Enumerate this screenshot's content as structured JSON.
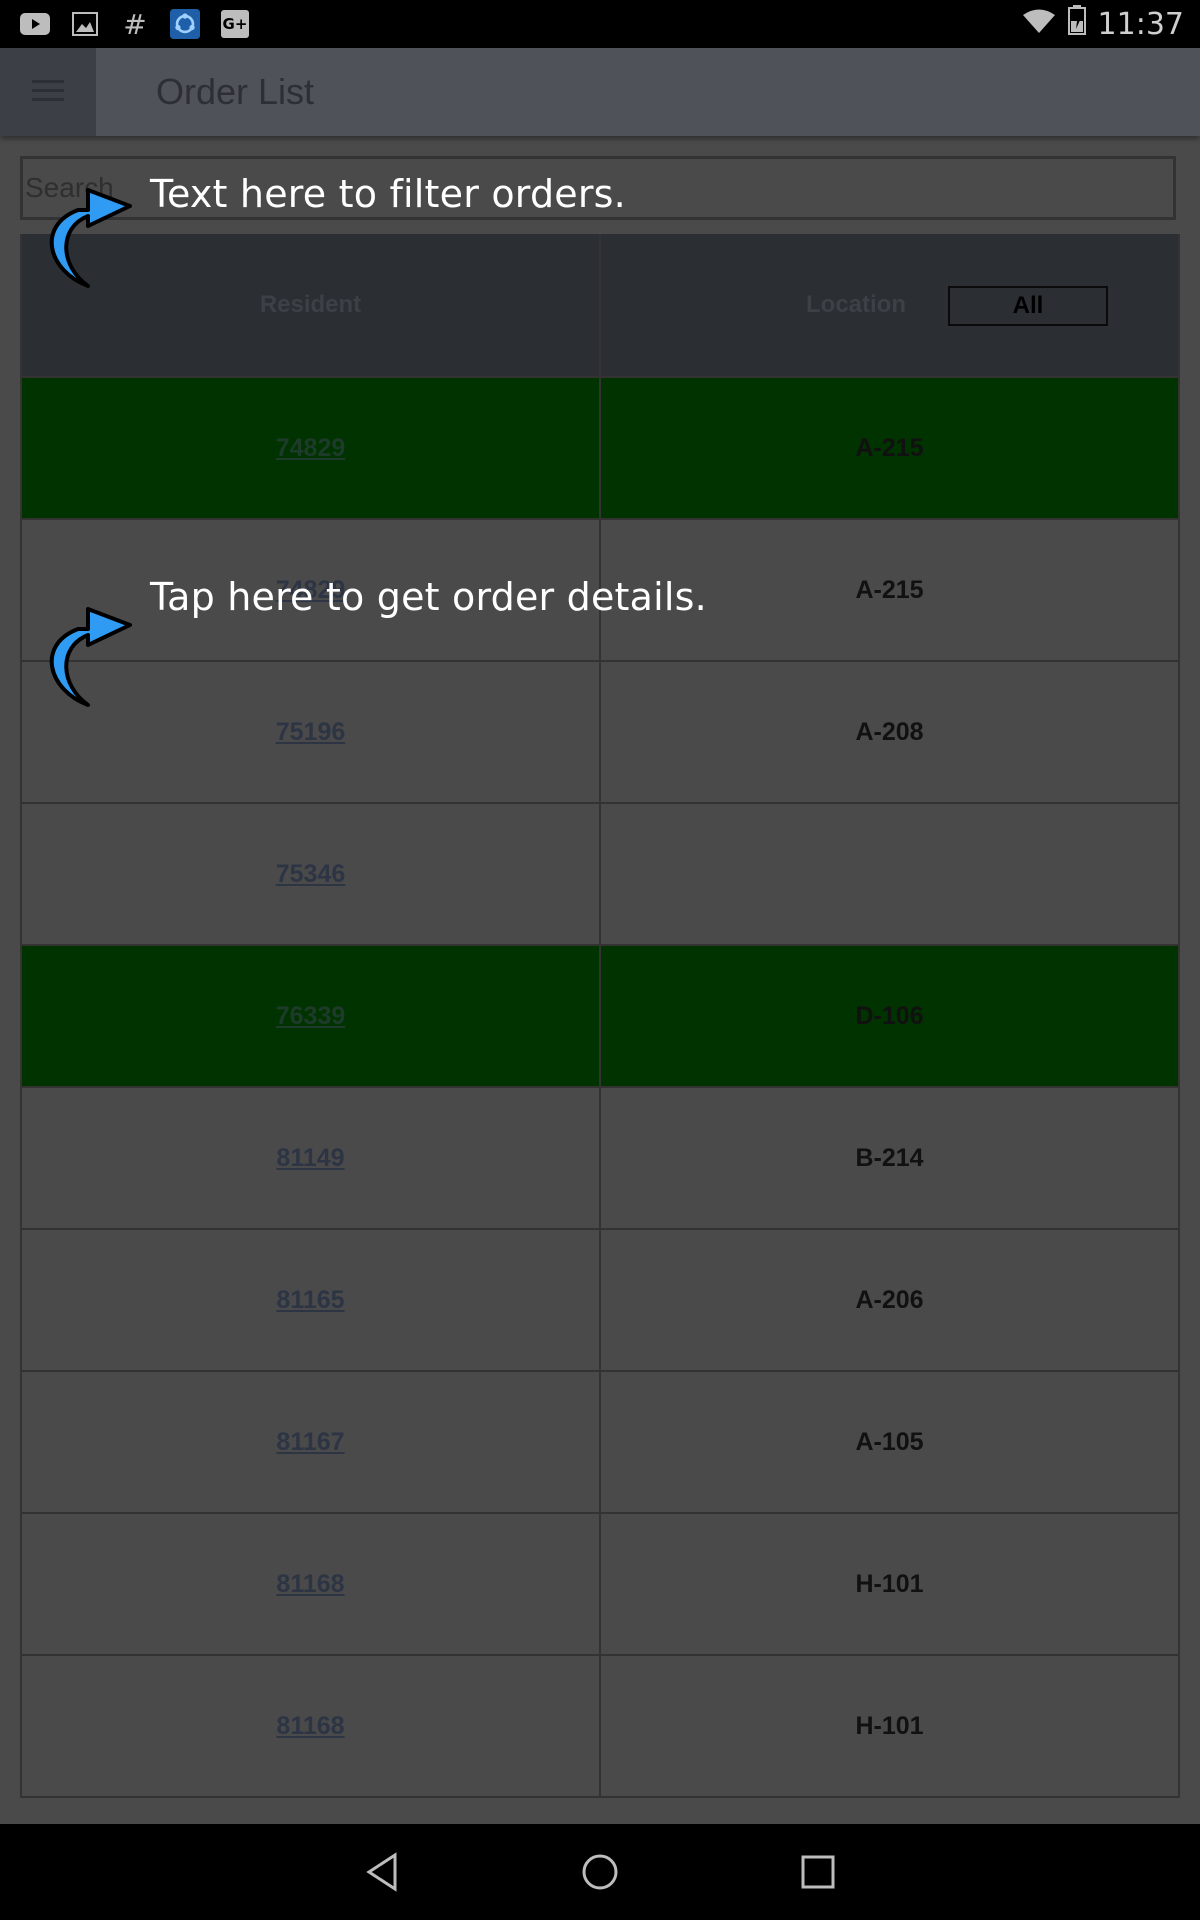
{
  "status_bar": {
    "time": "11:37",
    "left_icons": [
      "youtube-icon",
      "gallery-icon",
      "hashtag-icon",
      "sync-app-icon",
      "google-plus-icon"
    ],
    "right_icons": [
      "wifi-icon",
      "battery-charging-icon"
    ],
    "gplus_text": "G+",
    "hash_text": "#"
  },
  "app_bar": {
    "title": "Order List",
    "menu_icon": "hamburger-menu-icon"
  },
  "search": {
    "placeholder": "Search"
  },
  "table": {
    "headers": {
      "resident": "Resident",
      "location": "Location"
    },
    "filter_button": "All",
    "rows": [
      {
        "resident": "74829",
        "location": "A-215",
        "highlight": true
      },
      {
        "resident": "74829",
        "location": "A-215",
        "highlight": false
      },
      {
        "resident": "75196",
        "location": "A-208",
        "highlight": false
      },
      {
        "resident": "75346",
        "location": "",
        "highlight": false
      },
      {
        "resident": "76339",
        "location": "D-106",
        "highlight": true
      },
      {
        "resident": "81149",
        "location": "B-214",
        "highlight": false
      },
      {
        "resident": "81165",
        "location": "A-206",
        "highlight": false
      },
      {
        "resident": "81167",
        "location": "A-105",
        "highlight": false
      },
      {
        "resident": "81168",
        "location": "H-101",
        "highlight": false
      },
      {
        "resident": "81168",
        "location": "H-101",
        "highlight": false
      }
    ],
    "highlight_color": "#003300"
  },
  "overlay": {
    "search_tip": "Text here to filter orders.",
    "row_tip": "Tap here to get order details.",
    "arrow_color": "#2f9bf3"
  },
  "nav_bar": {
    "buttons": [
      "back-icon",
      "home-icon",
      "recents-icon"
    ]
  }
}
